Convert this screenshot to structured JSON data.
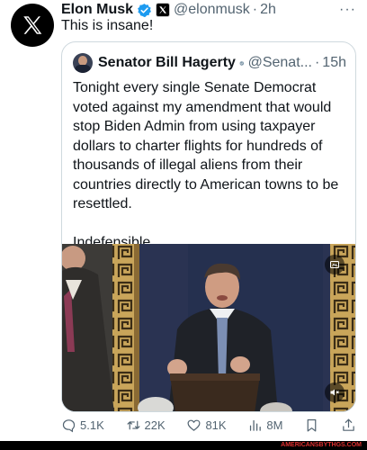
{
  "post": {
    "author_name": "Elon Musk",
    "handle": "@elonmusk",
    "separator": "·",
    "time": "2h",
    "more": "···",
    "text": "This is insane!"
  },
  "quote": {
    "author_name": "Senator Bill Hagerty",
    "handle": "@Senat...",
    "separator": "·",
    "time": "15h",
    "paragraph_1": "Tonight every single Senate Democrat voted against my amendment that would stop Biden Admin from using taxpayer dollars to charter flights for hundreds of thousands of illegal aliens from their countries directly to American towns to be resettled.",
    "paragraph_2": "Indefensible."
  },
  "actions": {
    "replies": "5.1K",
    "reposts": "22K",
    "likes": "81K",
    "views": "8M"
  },
  "footer": {
    "watermark": "AMERICANSBYTHGS.COM"
  },
  "colors": {
    "verified_blue": "#1d9bf0",
    "text_primary": "#0f1419",
    "text_secondary": "#536471",
    "border": "#cfd9de"
  },
  "icons": [
    "x-logo-icon",
    "verified-badge-icon",
    "x-affiliation-icon",
    "more-icon",
    "reply-icon",
    "repost-icon",
    "like-icon",
    "views-icon",
    "bookmark-icon",
    "share-icon",
    "media-settings-icon",
    "mute-icon"
  ]
}
